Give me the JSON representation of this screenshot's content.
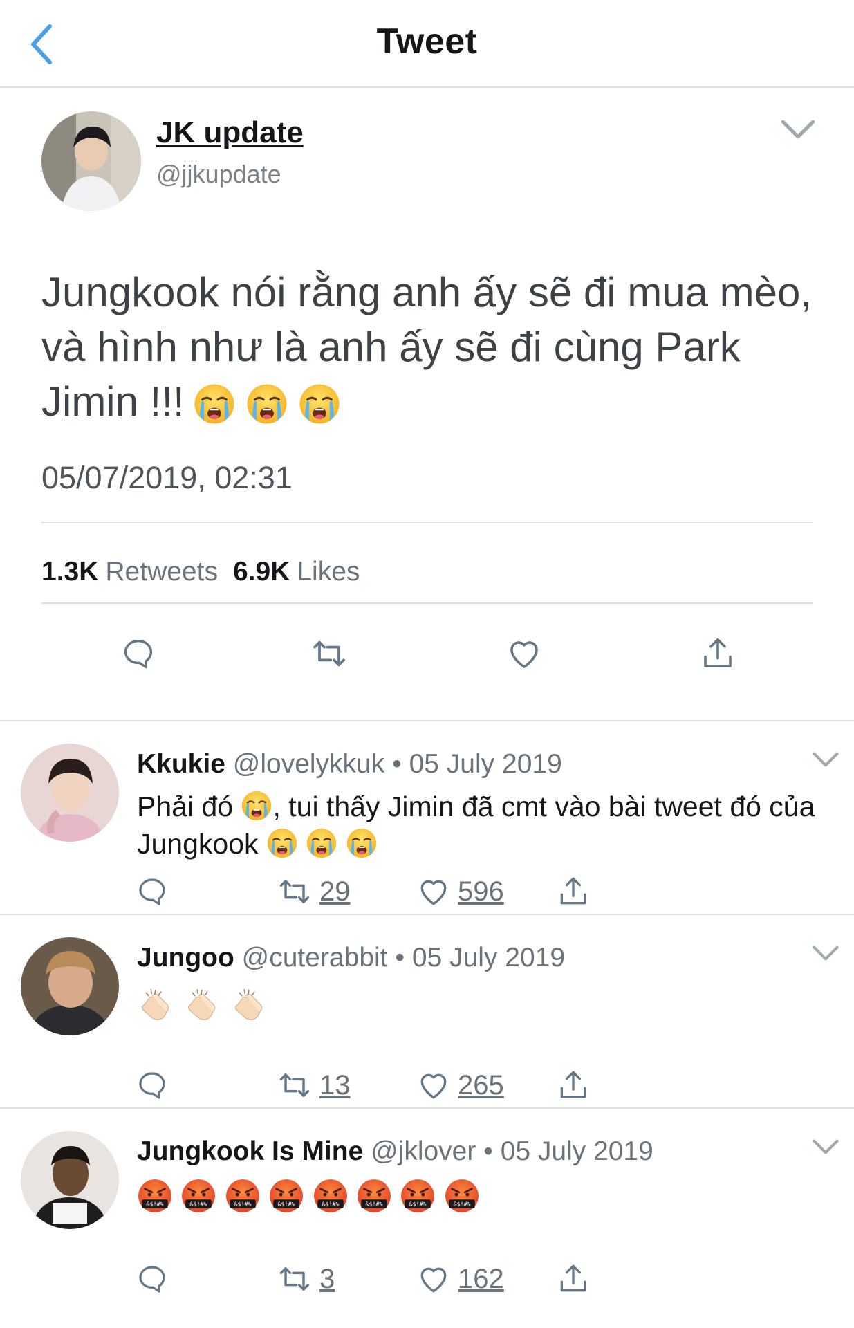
{
  "header": {
    "title": "Tweet"
  },
  "tweet": {
    "author": {
      "name": "JK update",
      "handle": "@jjkupdate"
    },
    "text": "Jungkook nói rằng anh ấy sẽ đi mua mèo, và hình như là anh ấy sẽ đi cùng Park Jimin !!!",
    "text_emoji": [
      "loudly-crying-face",
      "loudly-crying-face",
      "loudly-crying-face"
    ],
    "timestamp": "05/07/2019, 02:31",
    "retweets_count": "1.3K",
    "retweets_label": "Retweets",
    "likes_count": "6.9K",
    "likes_label": "Likes"
  },
  "replies": [
    {
      "name": "Kkukie",
      "handle": "@lovelykkuk",
      "dot": "•",
      "date": "05 July 2019",
      "text_part1": "Phải đó",
      "text_part2": ", tui thấy Jimin đã cmt vào bài tweet đó của Jungkook",
      "retweets": "29",
      "likes": "596"
    },
    {
      "name": "Jungoo",
      "handle": "@cuterabbit",
      "dot": "•",
      "date": "05 July 2019",
      "emoji": "clapping-hands x3",
      "retweets": "13",
      "likes": "265"
    },
    {
      "name": "Jungkook Is Mine",
      "handle": "@jklover",
      "dot": "•",
      "date": "05 July 2019",
      "emoji": "face-with-symbols-on-mouth x8",
      "retweets": "3",
      "likes": "162"
    }
  ],
  "colors": {
    "accent_blue": "#4a9ee6",
    "divider": "#dcdfe2",
    "muted_text": "#6b737a"
  }
}
